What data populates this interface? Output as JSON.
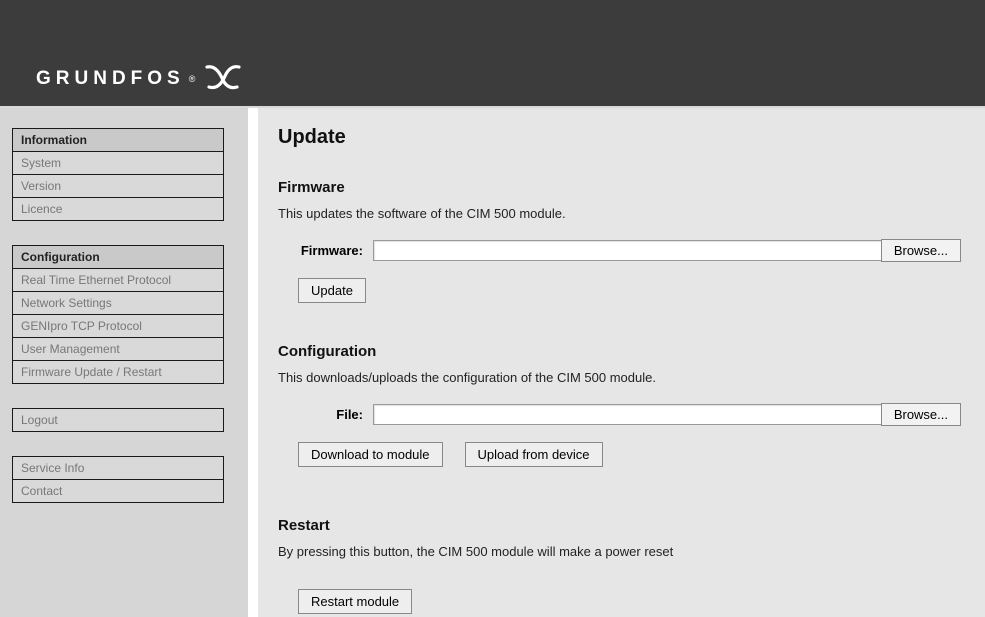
{
  "brand": {
    "name": "GRUNDFOS"
  },
  "sidebar": {
    "groups": [
      {
        "title": "Information",
        "items": [
          "System",
          "Version",
          "Licence"
        ]
      },
      {
        "title": "Configuration",
        "items": [
          "Real Time Ethernet Protocol",
          "Network Settings",
          "GENIpro TCP Protocol",
          "User Management",
          "Firmware Update / Restart"
        ]
      }
    ],
    "logout": "Logout",
    "footer_items": [
      "Service Info",
      "Contact"
    ]
  },
  "page": {
    "title": "Update",
    "firmware": {
      "heading": "Firmware",
      "desc": "This updates the software of the CIM 500 module.",
      "label": "Firmware:",
      "browse": "Browse...",
      "update_btn": "Update"
    },
    "config": {
      "heading": "Configuration",
      "desc": "This downloads/uploads the configuration of the CIM 500 module.",
      "label": "File:",
      "browse": "Browse...",
      "download_btn": "Download to module",
      "upload_btn": "Upload from device"
    },
    "restart": {
      "heading": "Restart",
      "desc": "By pressing this button, the CIM 500 module will make a power reset",
      "btn": "Restart module"
    }
  }
}
